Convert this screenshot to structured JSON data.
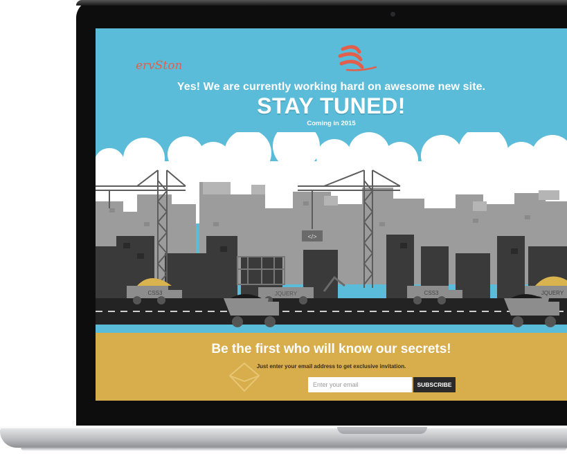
{
  "brand": {
    "logo_text": "ervSton",
    "accent": "#e35f4b"
  },
  "hero": {
    "headline": "Yes! We are currently working hard on awesome new site.",
    "title": "STAY TUNED!",
    "subtitle": "Coming in 2015"
  },
  "scene": {
    "sign_code": "</>",
    "truck_labels": [
      "CSS3",
      "JQUERY",
      "CSS3",
      "JQUERY"
    ]
  },
  "subscribe": {
    "heading": "Be the first who will know our secrets!",
    "description": "Just enter your email address to get exclusive invitation.",
    "email_placeholder": "Enter your email",
    "email_value": "",
    "button_label": "SUBSCRIBE",
    "icon": "envelope-icon"
  },
  "colors": {
    "sky": "#5bbcd9",
    "footer": "#d8ad4c",
    "road": "#222222",
    "button": "#2a2a2a"
  }
}
